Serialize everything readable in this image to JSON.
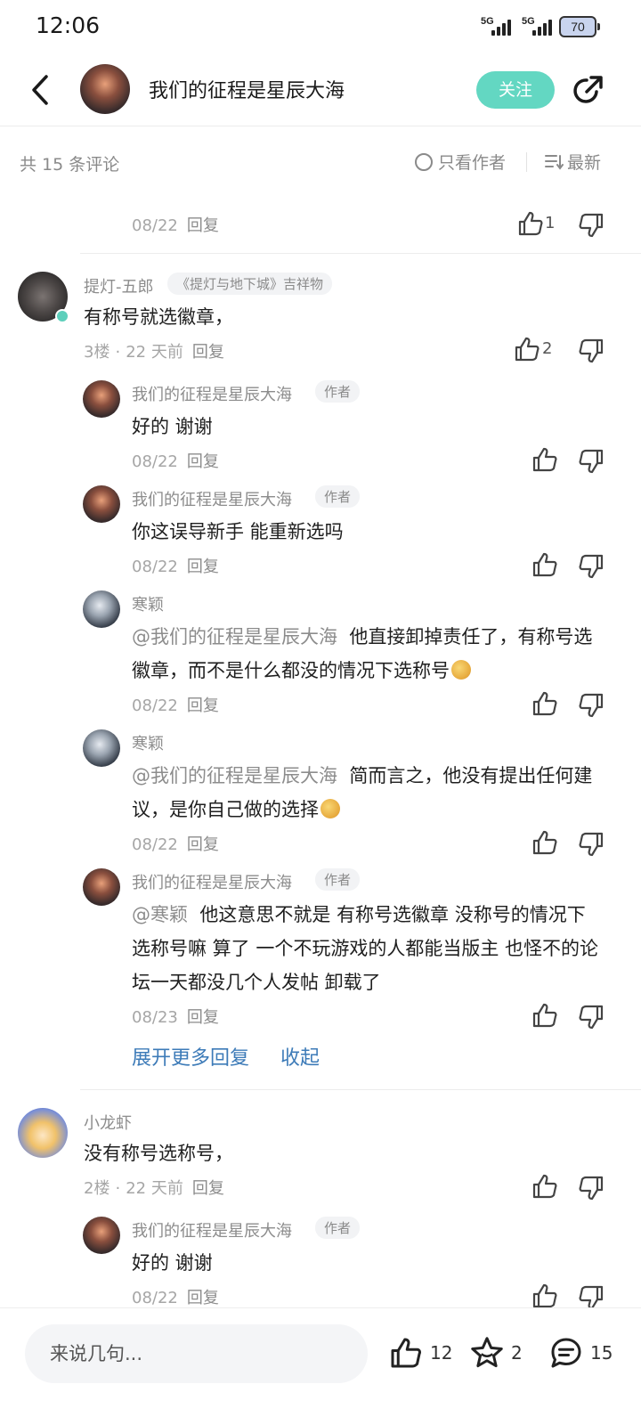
{
  "status": {
    "time": "12:06",
    "sig1": "5G",
    "sig2": "5G",
    "battery": "70"
  },
  "header": {
    "title": "我们的征程是星辰大海",
    "follow_label": "关注"
  },
  "filter": {
    "count_text": "共 15 条评论",
    "only_author": "只看作者",
    "sort": "最新"
  },
  "comments": {
    "partial": {
      "date": "08/22",
      "reply": "回复",
      "likes": "1"
    },
    "c3": {
      "name": "提灯-五郎",
      "badge": "《提灯与地下城》吉祥物",
      "text": "有称号就选徽章，",
      "floor": "3楼",
      "time": "22 天前",
      "reply": "回复",
      "likes": "2",
      "replies": [
        {
          "name": "我们的征程是星辰大海",
          "tag": "作者",
          "text": "好的 谢谢",
          "date": "08/22",
          "reply": "回复"
        },
        {
          "name": "我们的征程是星辰大海",
          "tag": "作者",
          "text": "你这误导新手  能重新选吗",
          "date": "08/22",
          "reply": "回复"
        },
        {
          "name": "寒颖",
          "mention": "@我们的征程是星辰大海",
          "text": "他直接卸掉责任了，有称号选徽章，而不是什么都没的情况下选称号",
          "date": "08/22",
          "reply": "回复"
        },
        {
          "name": "寒颖",
          "mention": "@我们的征程是星辰大海",
          "text": "简而言之，他没有提出任何建议，是你自己做的选择",
          "date": "08/22",
          "reply": "回复"
        },
        {
          "name": "我们的征程是星辰大海",
          "tag": "作者",
          "mention": "@寒颖",
          "text": "他这意思不就是  有称号选徽章 没称号的情况下选称号嘛  算了  一个不玩游戏的人都能当版主 也怪不的论坛一天都没几个人发帖 卸载了",
          "date": "08/23",
          "reply": "回复"
        }
      ],
      "expand_more": "展开更多回复",
      "collapse": "收起"
    },
    "c2": {
      "name": "小龙虾",
      "text": "没有称号选称号，",
      "floor": "2楼",
      "time": "22 天前",
      "reply": "回复",
      "replies": [
        {
          "name": "我们的征程是星辰大海",
          "tag": "作者",
          "text": "好的 谢谢",
          "date": "08/22",
          "reply": "回复"
        }
      ]
    }
  },
  "bottom": {
    "input_placeholder": "来说几句...",
    "likes": "12",
    "stars": "2",
    "comments": "15"
  },
  "colors": {
    "accent": "#63d7c2",
    "link": "#3d7bb8",
    "muted": "#8c8c8c"
  }
}
